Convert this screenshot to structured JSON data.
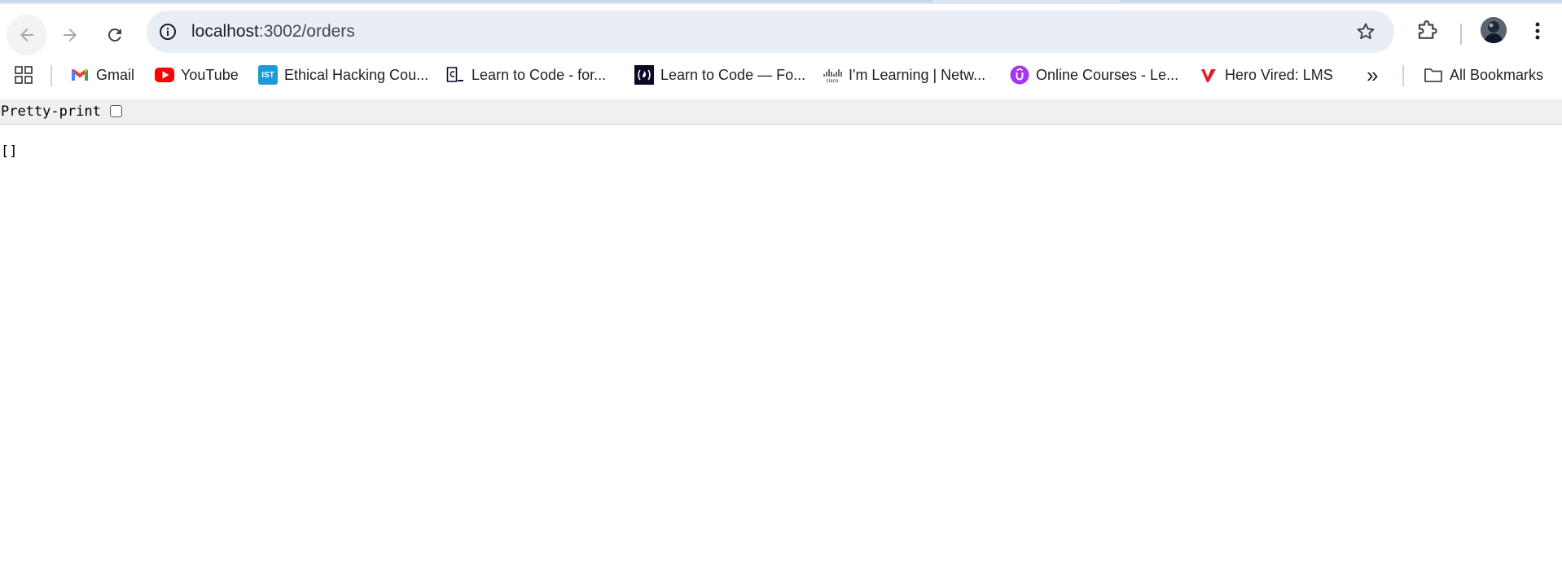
{
  "browser": {
    "url_host": "localhost",
    "url_rest": ":3002/orders",
    "bookmarks": [
      {
        "label": "Gmail",
        "icon": "gmail-icon"
      },
      {
        "label": "YouTube",
        "icon": "youtube-icon"
      },
      {
        "label": "Ethical Hacking Cou...",
        "icon": "ist-icon",
        "icon_text": "IST"
      },
      {
        "label": "Learn to Code - for...",
        "icon": "codecademy-icon"
      },
      {
        "label": "Learn to Code — Fo...",
        "icon": "freecodecamp-icon"
      },
      {
        "label": "I'm Learning | Netw...",
        "icon": "cisco-icon"
      },
      {
        "label": "Online Courses - Le...",
        "icon": "udemy-icon"
      },
      {
        "label": "Hero Vired: LMS",
        "icon": "herovired-icon"
      }
    ],
    "overflow_label": "»",
    "all_bookmarks_label": "All Bookmarks"
  },
  "page": {
    "pretty_print_label": "Pretty-print",
    "pretty_print_checked": false,
    "json_content": "[]"
  },
  "colors": {
    "toolbar_bg": "#ffffff",
    "omnibox_bg": "#e9eef6",
    "pretty_print_bar_bg": "#f0f0f0"
  }
}
